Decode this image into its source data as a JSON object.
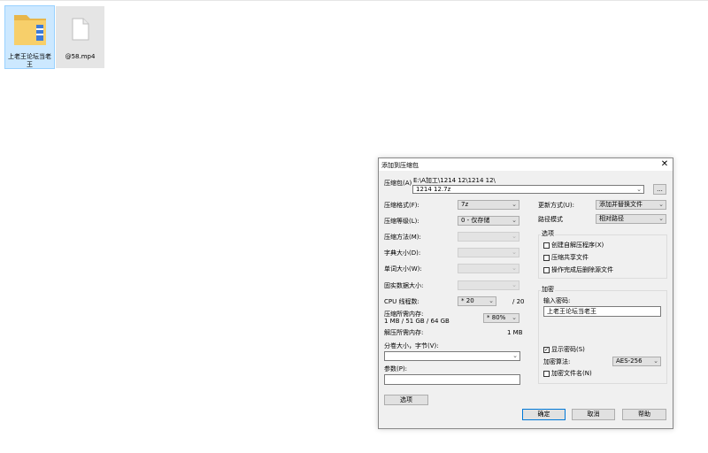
{
  "desktop": {
    "items": [
      {
        "label": "上老王论坛当老王",
        "icon": "folder-icon"
      },
      {
        "label": "@58.mp4",
        "icon": "file-icon"
      }
    ]
  },
  "dialog": {
    "title": "添加到压缩包",
    "close": "✕",
    "archive": {
      "label": "压缩包(A)",
      "path": "E:\\A加工\\1214 12\\1214 12\\",
      "name": "1214 12.7z",
      "browse": "..."
    },
    "left": {
      "format_label": "压缩格式(F):",
      "format_value": "7z",
      "level_label": "压缩等级(L):",
      "level_value": "0 - 仅存储",
      "method_label": "压缩方法(M):",
      "dict_label": "字典大小(D):",
      "word_label": "单词大小(W):",
      "solid_label": "固实数据大小:",
      "cpu_label": "CPU 线程数:",
      "cpu_value": "20",
      "cpu_total": "/ 20",
      "mem_label": "压缩所需内存:",
      "mem_value": "1 MB / 51 GB / 64 GB",
      "mem_pct": "80%",
      "decomp_label": "解压所需内存:",
      "decomp_value": "1 MB",
      "split_label": "分卷大小，字节(V):",
      "params_label": "参数(P):",
      "options_button": "选项"
    },
    "right": {
      "update_label": "更新方式(U):",
      "update_value": "添加并替换文件",
      "pathmode_label": "路径模式",
      "pathmode_value": "相对路径",
      "options_group": "选项",
      "opt1": "创建自解压程序(X)",
      "opt2": "压缩共享文件",
      "opt3": "操作完成后删除源文件",
      "encrypt_group": "加密",
      "pwd_label": "输入密码:",
      "pwd_value": "上老王论坛当老王",
      "show_pwd": "显示密码(S)",
      "algo_label": "加密算法:",
      "algo_value": "AES-256",
      "enc_names": "加密文件名(N)"
    },
    "buttons": {
      "ok": "确定",
      "cancel": "取消",
      "help": "帮助"
    }
  }
}
